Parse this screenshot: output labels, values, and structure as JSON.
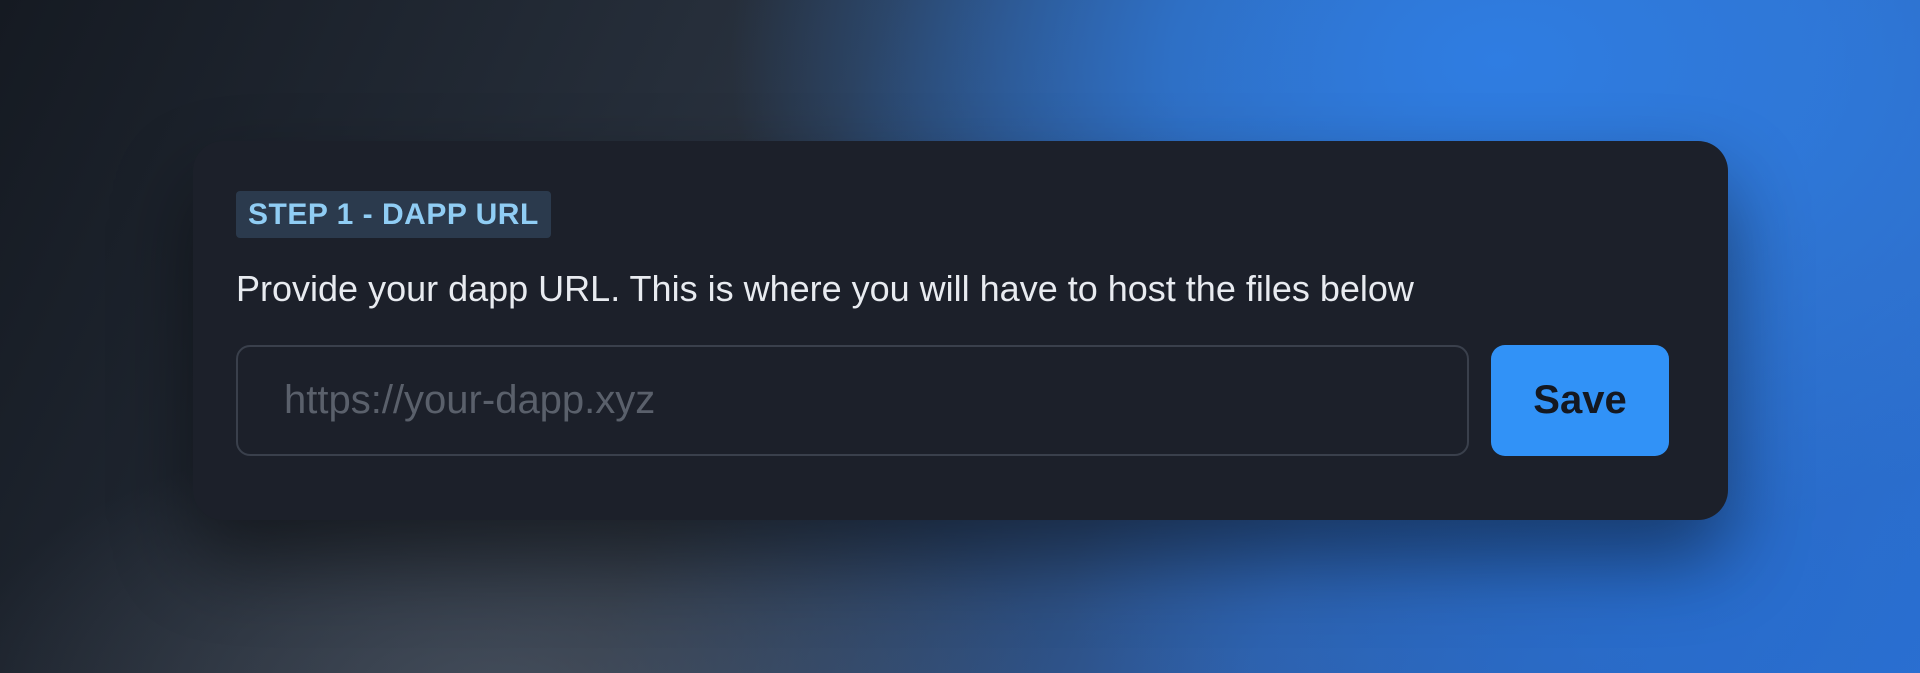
{
  "card": {
    "step_label": "STEP 1 - DAPP URL",
    "description": "Provide your dapp URL. This is where you will have to host the files below",
    "url_input": {
      "value": "",
      "placeholder": "https://your-dapp.xyz"
    },
    "save_label": "Save"
  },
  "colors": {
    "card_background": "#1c202a",
    "badge_background": "#2b3a4d",
    "badge_text": "#90cdf4",
    "accent": "#3192f7"
  }
}
